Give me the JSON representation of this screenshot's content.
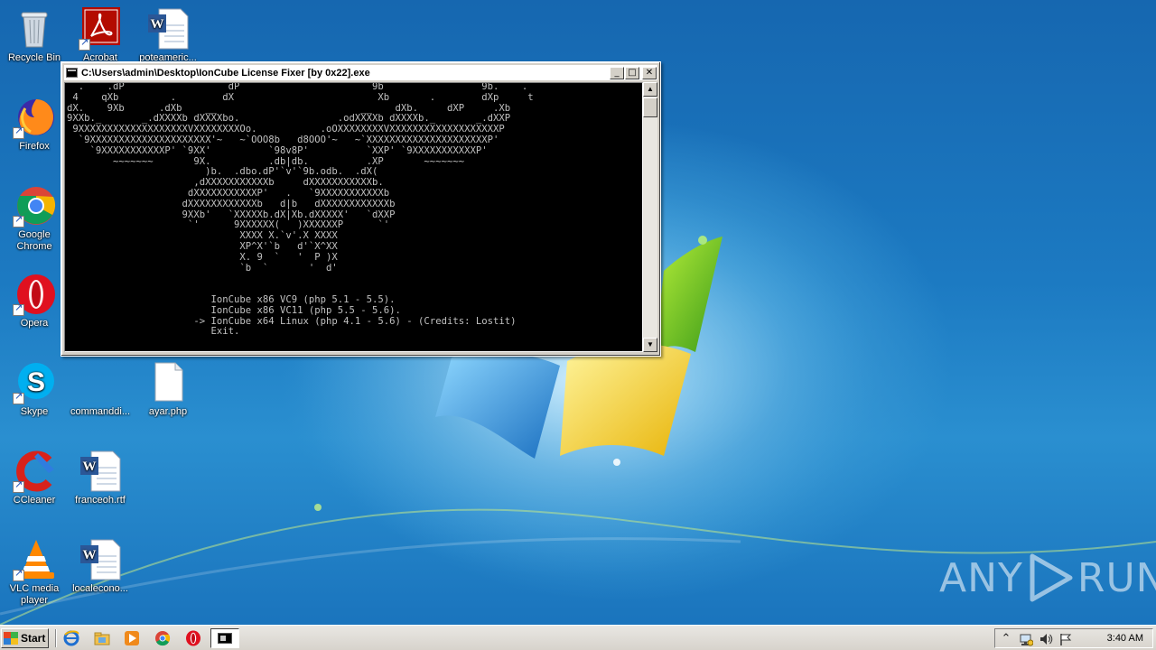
{
  "desktop": {
    "icons": [
      {
        "label": "Recycle Bin",
        "icon": "recycle-bin-icon"
      },
      {
        "label": "Acrobat",
        "icon": "acrobat-icon"
      },
      {
        "label": "poteameric...",
        "icon": "word-document-icon"
      },
      {
        "label": "Firefox",
        "icon": "firefox-icon"
      },
      {
        "label": "Google Chrome",
        "icon": "chrome-icon"
      },
      {
        "label": "Opera",
        "icon": "opera-icon"
      },
      {
        "label": "Skype",
        "icon": "skype-icon"
      },
      {
        "label": "commanddi...",
        "icon": "blank-file-icon"
      },
      {
        "label": "ayar.php",
        "icon": "blank-file-icon"
      },
      {
        "label": "CCleaner",
        "icon": "ccleaner-icon"
      },
      {
        "label": "franceoh.rtf",
        "icon": "word-document-icon"
      },
      {
        "label": "VLC media player",
        "icon": "vlc-icon"
      },
      {
        "label": "localecono...",
        "icon": "word-document-icon"
      }
    ]
  },
  "console": {
    "title": "C:\\Users\\admin\\Desktop\\IonCube License Fixer [by 0x22].exe",
    "lines": [
      "  .    .dP                  dP                       9b                 9b.    .",
      " 4    qXb         .        dX                         Xb       .        dXp     t",
      "dX.    9Xb      .dXb    __                         __    dXb.     dXP     .Xb",
      "9XXb._       _.dXXXXb dXXXXbo.                 .odXXXXb dXXXXb._       _.dXXP",
      " 9XXXXXXXXXXXXXXXXXXXVXXXXXXXXOo.           .oOXXXXXXXXVXXXXXXXXXXXXXXXXXXXP",
      "  `9XXXXXXXXXXXXXXXXXXXXX'~   ~`OOO8b   d8OOO'~   ~`XXXXXXXXXXXXXXXXXXXXXP'",
      "    `9XXXXXXXXXXXP' `9XX'          `98v8P'          `XXP' `9XXXXXXXXXXXP'",
      "        ~~~~~~~       9X.          .db|db.          .XP       ~~~~~~~",
      "                        )b.  .dbo.dP'`v'`9b.odb.  .dX(",
      "                      ,dXXXXXXXXXXXb     dXXXXXXXXXXXb.",
      "                     dXXXXXXXXXXXP'   .   `9XXXXXXXXXXXb",
      "                    dXXXXXXXXXXXXb   d|b   dXXXXXXXXXXXXb",
      "                    9XXb'   `XXXXXb.dX|Xb.dXXXXX'   `dXXP",
      "                     `'      9XXXXXX(   )XXXXXXP      `'",
      "                              XXXX X.`v'.X XXXX",
      "                              XP^X'`b   d'`X^XX",
      "                              X. 9  `   '  P )X",
      "                              `b  `       '  d'",
      "",
      "",
      "                         IonCube x86 VC9 (php 5.1 - 5.5).",
      "                         IonCube x86 VC11 (php 5.5 - 5.6).",
      "                      -> IonCube x64 Linux (php 4.1 - 5.6) - (Credits: Lostit)",
      "                         Exit."
    ]
  },
  "watermark": {
    "left": "ANY",
    "right": "RUN"
  },
  "taskbar": {
    "start_label": "Start",
    "quicklaunch": [
      "ie-icon",
      "explorer-icon",
      "media-player-icon",
      "chrome-icon",
      "opera-icon"
    ],
    "tray": [
      "show-hidden-icons-icon",
      "network-icon",
      "volume-icon",
      "action-center-flag-icon"
    ],
    "clock": "3:40 AM"
  }
}
